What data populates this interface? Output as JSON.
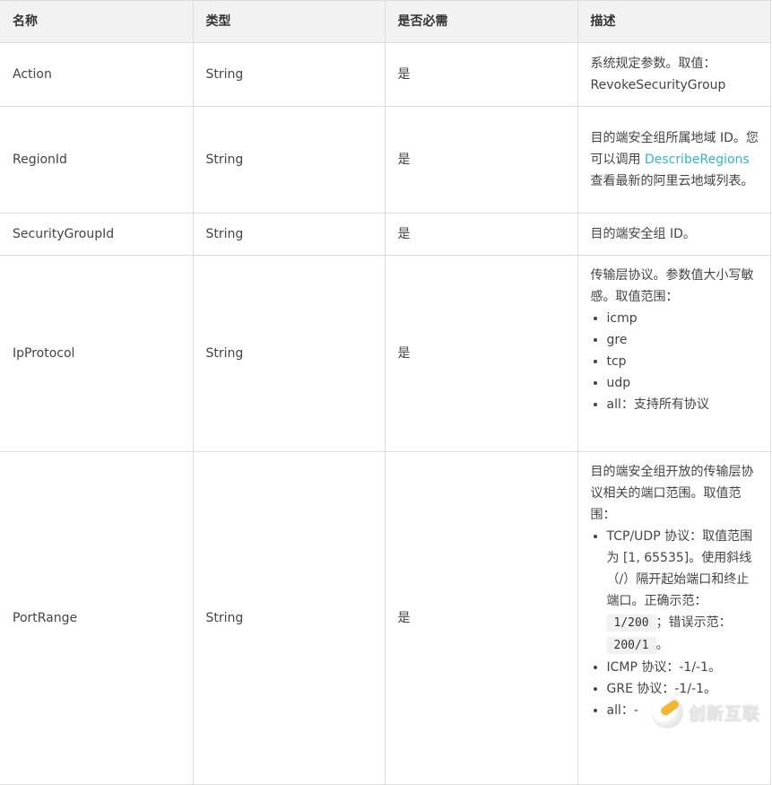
{
  "table": {
    "headers": [
      "名称",
      "类型",
      "是否必需",
      "描述"
    ],
    "rows": [
      {
        "name": "Action",
        "type": "String",
        "required": "是",
        "desc_text": "系统规定参数。取值：RevokeSecurityGroup"
      },
      {
        "name": "RegionId",
        "type": "String",
        "required": "是",
        "desc_prefix": "目的端安全组所属地域 ID。您可以调用 ",
        "desc_link": "DescribeRegions",
        "desc_suffix": " 查看最新的阿里云地域列表。"
      },
      {
        "name": "SecurityGroupId",
        "type": "String",
        "required": "是",
        "desc_text": "目的端安全组 ID。"
      },
      {
        "name": "IpProtocol",
        "type": "String",
        "required": "是",
        "desc_text": "传输层协议。参数值大小写敏感。取值范围：",
        "options": [
          "icmp",
          "gre",
          "tcp",
          "udp",
          "all：支持所有协议"
        ]
      },
      {
        "name": "PortRange",
        "type": "String",
        "required": "是",
        "desc_text": "目的端安全组开放的传输层协议相关的端口范围。取值范围：",
        "tcp_udp": {
          "prefix": "TCP/UDP 协议：取值范围为 [1, 65535]。使用斜线（/）隔开起始端口和终止端口。正确示范：",
          "correct_example": "1/200",
          "middle": "；错误示范：",
          "wrong_example": "200/1",
          "suffix": "。"
        },
        "options": [
          "ICMP 协议：-1/-1。",
          "GRE 协议：-1/-1。",
          "all：-"
        ]
      }
    ]
  },
  "watermark": {
    "text": "创新互联"
  }
}
